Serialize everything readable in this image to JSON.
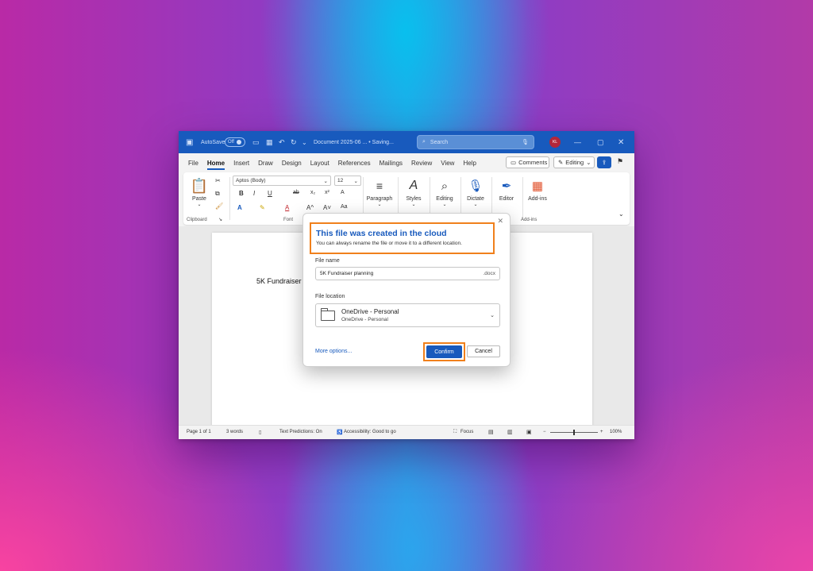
{
  "titlebar": {
    "autosave_label": "AutoSave",
    "autosave_state": "Off",
    "document_title": "Document 2025-06 ... • Saving...",
    "search_placeholder": "Search",
    "avatar_initials": "KL"
  },
  "menu": {
    "tabs": [
      "File",
      "Home",
      "Insert",
      "Draw",
      "Design",
      "Layout",
      "References",
      "Mailings",
      "Review",
      "View",
      "Help"
    ],
    "active_tab": "Home",
    "comments_label": "Comments",
    "editing_label": "Editing"
  },
  "ribbon": {
    "paste_label": "Paste",
    "clipboard_label": "Clipboard",
    "font_name": "Aptos (Body)",
    "font_size": "12",
    "font_label": "Font",
    "paragraph_label": "Paragraph",
    "styles_label": "Styles",
    "editing_label": "Editing",
    "dictate_label": "Dictate",
    "editor_label": "Editor",
    "addins_label": "Add-ins",
    "addins_group_label": "Add-ins",
    "format_buttons": [
      "B",
      "I",
      "U",
      "ab",
      "x₂",
      "x²",
      "A"
    ],
    "format_buttons_2": [
      "A",
      "A",
      "A",
      "A^",
      "A˅",
      "Aa"
    ]
  },
  "document": {
    "text": "5K Fundraiser"
  },
  "dialog": {
    "title": "This file was created in the cloud",
    "subtitle": "You can always rename the file or move it to a different location.",
    "file_name_label": "File name",
    "file_name_value": "5K Fundraiser planning",
    "file_extension": ".docx",
    "file_location_label": "File location",
    "location_main": "OneDrive - Personal",
    "location_sub": "OneDrive - Personal",
    "more_options": "More options...",
    "confirm_label": "Confirm",
    "cancel_label": "Cancel"
  },
  "statusbar": {
    "page": "Page 1 of 1",
    "words": "3 words",
    "text_predictions": "Text Predictions: On",
    "accessibility": "Accessibility: Good to go",
    "focus": "Focus",
    "zoom": "100%",
    "zoom_level": 1.0
  },
  "colors": {
    "accent": "#185abd",
    "highlight": "#f0801c"
  }
}
